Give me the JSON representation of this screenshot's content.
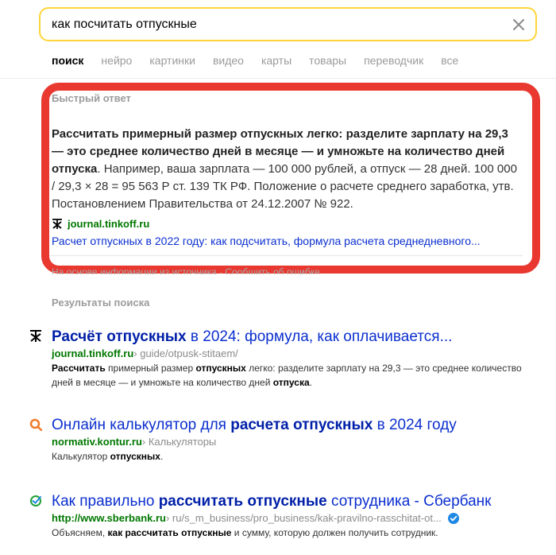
{
  "search": {
    "query": "как посчитать отпускные"
  },
  "tabs": [
    {
      "label": "поиск"
    },
    {
      "label": "нейро"
    },
    {
      "label": "картинки"
    },
    {
      "label": "видео"
    },
    {
      "label": "карты"
    },
    {
      "label": "товары"
    },
    {
      "label": "переводчик"
    },
    {
      "label": "все"
    }
  ],
  "quick_answer": {
    "title": "Быстрый ответ",
    "bold_text": "Рассчитать примерный размер отпускных легко: разделите зарплату на 29,3 — это среднее количество дней в месяце — и умножьте на количество дней отпуска",
    "text": ". Например, ваша зарплата — 100 000 рублей, а отпуск — 28 дней. 100 000 / 29,3 × 28 = 95 563 Р ст. 139 ТК РФ. Положение о расчете среднего заработка, утв. Постановлением Правительства от 24.12.2007 № 922.",
    "source_domain": "journal.tinkoff.ru",
    "link_text": "Расчет отпускных в 2022 году: как подсчитать, формула расчета среднедневного...",
    "under_text": "На основе информации из источника · Сообщить об ошибке"
  },
  "results_title": "Результаты поиска",
  "results": [
    {
      "title_bold": "Расчёт отпускных",
      "title_rest": " в 2024: формула, как оплачивается...",
      "domain": "journal.tinkoff.ru",
      "path": " › guide/otpusk-stitaem/",
      "snippet_b1": "Рассчитать",
      "snippet_t1": " примерный размер ",
      "snippet_b2": "отпускных",
      "snippet_t2": " легко: разделите зарплату на 29,3 — это среднее количество дней в месяце — и умножьте на количество дней ",
      "snippet_b3": "отпуска",
      "snippet_t3": "."
    },
    {
      "title_pre": "Онлайн калькулятор для ",
      "title_bold": "расчета отпускных",
      "title_rest": " в 2024 году",
      "domain": "normativ.kontur.ru",
      "path": " › Калькуляторы",
      "snippet_t1": "Калькулятор ",
      "snippet_b1": "отпускных",
      "snippet_t2": "."
    },
    {
      "title_pre": "Как правильно ",
      "title_bold": "рассчитать отпускные",
      "title_rest": " сотрудника - Сбербанк",
      "domain": "http://www.sberbank.ru",
      "path": " › ru/s_m_business/pro_business/kak-pravilno-rasschitat-ot...",
      "snippet_t1": "Объясняем, ",
      "snippet_b1": "как рассчитать отпускные",
      "snippet_t2": " и сумму, которую должен получить сотрудник."
    }
  ],
  "colors": {
    "accent_yellow": "#fdd53b",
    "highlight_red": "#e8382f",
    "link_blue": "#0b2fcf",
    "url_green": "#007700"
  },
  "icons": [
    "close-icon",
    "tinkoff-favicon-icon",
    "kontur-favicon-icon",
    "sber-favicon-icon",
    "verified-check-icon"
  ]
}
